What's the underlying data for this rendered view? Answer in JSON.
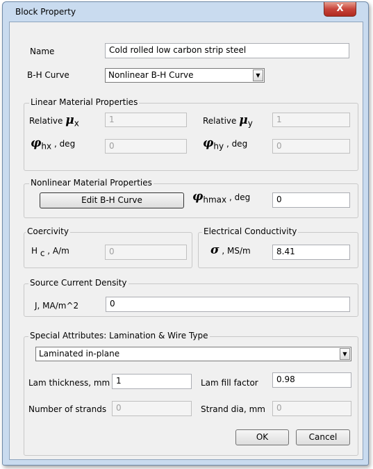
{
  "window": {
    "title": "Block Property",
    "close_glyph": "X"
  },
  "name": {
    "label": "Name",
    "value": "Cold rolled low carbon strip steel"
  },
  "bh_curve": {
    "label": "B-H Curve",
    "value": "Nonlinear B-H Curve"
  },
  "linear": {
    "title": "Linear Material Properties",
    "mu_x_prefix": "Relative",
    "mu_symbol": "μ",
    "mu_x_sub": "x",
    "mu_x_value": "1",
    "mu_y_prefix": "Relative",
    "mu_y_sub": "y",
    "mu_y_value": "1",
    "phi_symbol": "φ",
    "phi_hx_sub": "hx",
    "phi_hx_unit": ", deg",
    "phi_hx_value": "0",
    "phi_hy_sub": "hy",
    "phi_hy_unit": ", deg",
    "phi_hy_value": "0"
  },
  "nonlinear": {
    "title": "Nonlinear Material Properties",
    "edit_button": "Edit B-H Curve",
    "phi_hmax_sub": "hmax",
    "phi_hmax_unit": ", deg",
    "phi_hmax_value": "0"
  },
  "coercivity": {
    "title": "Coercivity",
    "h_symbol": "H",
    "h_sub": "c",
    "unit": ", A/m",
    "value": "0"
  },
  "conductivity": {
    "title": "Electrical Conductivity",
    "sigma_symbol": "σ",
    "unit": ", MS/m",
    "value": "8.41"
  },
  "source_current": {
    "title": "Source Current Density",
    "label": "J, MA/m^2",
    "value": "0"
  },
  "special": {
    "title": "Special Attributes:  Lamination & Wire Type",
    "type_value": "Laminated in-plane",
    "lam_thickness_label": "Lam thickness, mm",
    "lam_thickness_value": "1",
    "lam_fill_label": "Lam fill factor",
    "lam_fill_value": "0.98",
    "strands_label": "Number of strands",
    "strands_value": "0",
    "strand_dia_label": "Strand dia, mm",
    "strand_dia_value": "0"
  },
  "buttons": {
    "ok": "OK",
    "cancel": "Cancel"
  }
}
